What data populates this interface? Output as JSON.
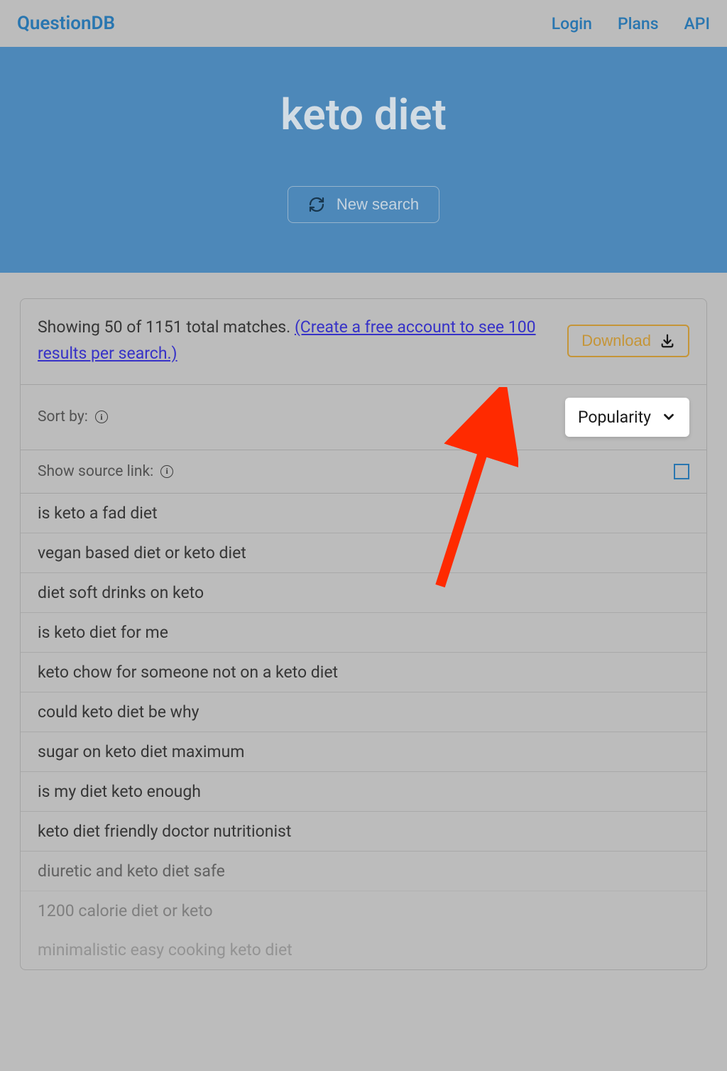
{
  "header": {
    "logo": "QuestionDB",
    "nav": {
      "login": "Login",
      "plans": "Plans",
      "api": "API"
    }
  },
  "hero": {
    "title": "keto diet",
    "newSearch": "New search"
  },
  "summary": {
    "prefix": "Showing 50 of 1151 total matches. ",
    "link": "(Create a free account to see 100 results per search.)",
    "download": "Download"
  },
  "sort": {
    "label": "Sort by:",
    "selected": "Popularity"
  },
  "source": {
    "label": "Show source link:"
  },
  "results": [
    "is keto a fad diet",
    "vegan based diet or keto diet",
    "diet soft drinks on keto",
    "is keto diet for me",
    "keto chow for someone not on a keto diet",
    "could keto diet be why",
    "sugar on keto diet maximum",
    "is my diet keto enough",
    "keto diet friendly doctor nutritionist",
    "diuretic and keto diet safe",
    "1200 calorie diet or keto",
    "minimalistic easy cooking keto diet"
  ]
}
